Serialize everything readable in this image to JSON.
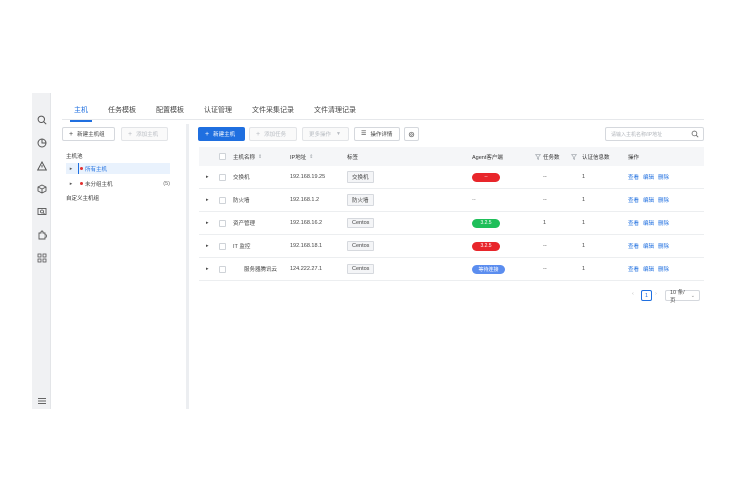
{
  "rail": {
    "icons": [
      "search-icon",
      "pie-chart-icon",
      "warning-icon",
      "cube-icon",
      "image-search-icon",
      "puzzle-icon",
      "grid-nodes-icon"
    ],
    "bottom_icon": "menu-list-icon"
  },
  "tabs": [
    {
      "label": "主机",
      "active": true
    },
    {
      "label": "任务模板",
      "active": false
    },
    {
      "label": "配置模板",
      "active": false
    },
    {
      "label": "认证管理",
      "active": false
    },
    {
      "label": "文件采集记录",
      "active": false
    },
    {
      "label": "文件清理记录",
      "active": false
    }
  ],
  "left_panel": {
    "new_group_btn": "新建主机组",
    "add_host_btn": "添加主机",
    "section_title": "主机池",
    "tree": [
      {
        "label": "所有主机",
        "count": "",
        "selected": true
      },
      {
        "label": "未分组主机",
        "count": "(5)",
        "selected": false
      }
    ],
    "custom_title": "自定义主机组"
  },
  "toolbar": {
    "new_host_btn": "新建主机",
    "add_task_btn": "添加任务",
    "more_btn": "更多操作",
    "detail_btn": "操作详情",
    "search_placeholder": "请输入主机名称/IP地址"
  },
  "table": {
    "headers": {
      "name": "主机名称",
      "ip": "IP地址",
      "tag": "标签",
      "agent": "Agent客户端",
      "tasks": "任务数",
      "auth": "认证信息数",
      "ops": "操作"
    },
    "rows": [
      {
        "name": "交换机",
        "ip": "192.168.19.25",
        "tag": "交换机",
        "agent": "--",
        "agent_status": "red",
        "tasks": "--",
        "auth": "1"
      },
      {
        "name": "防火墙",
        "ip": "192.168.1.2",
        "tag": "防火墙",
        "agent": "--",
        "agent_status": "none",
        "tasks": "--",
        "auth": "1"
      },
      {
        "name": "资产管理",
        "ip": "192.168.16.2",
        "tag": "Centos",
        "agent": "3.2.5",
        "agent_status": "green",
        "tasks": "1",
        "auth": "1"
      },
      {
        "name": "IT 监控",
        "ip": "192.168.18.1",
        "tag": "Centos",
        "agent": "3.2.5",
        "agent_status": "red",
        "tasks": "--",
        "auth": "1"
      },
      {
        "name": "服务器腾讯云",
        "ip": "124.222.27.1",
        "tag": "Centos",
        "agent": "等待连接",
        "agent_status": "blue",
        "tasks": "--",
        "auth": "1"
      }
    ],
    "actions": {
      "view": "查看",
      "edit": "编辑",
      "delete": "删除"
    }
  },
  "pagination": {
    "current_page": "1",
    "page_size": "10 条/页"
  },
  "colors": {
    "primary": "#1f6fe0",
    "danger": "#e8262b",
    "success": "#1fbf5a",
    "info": "#5b8def"
  }
}
